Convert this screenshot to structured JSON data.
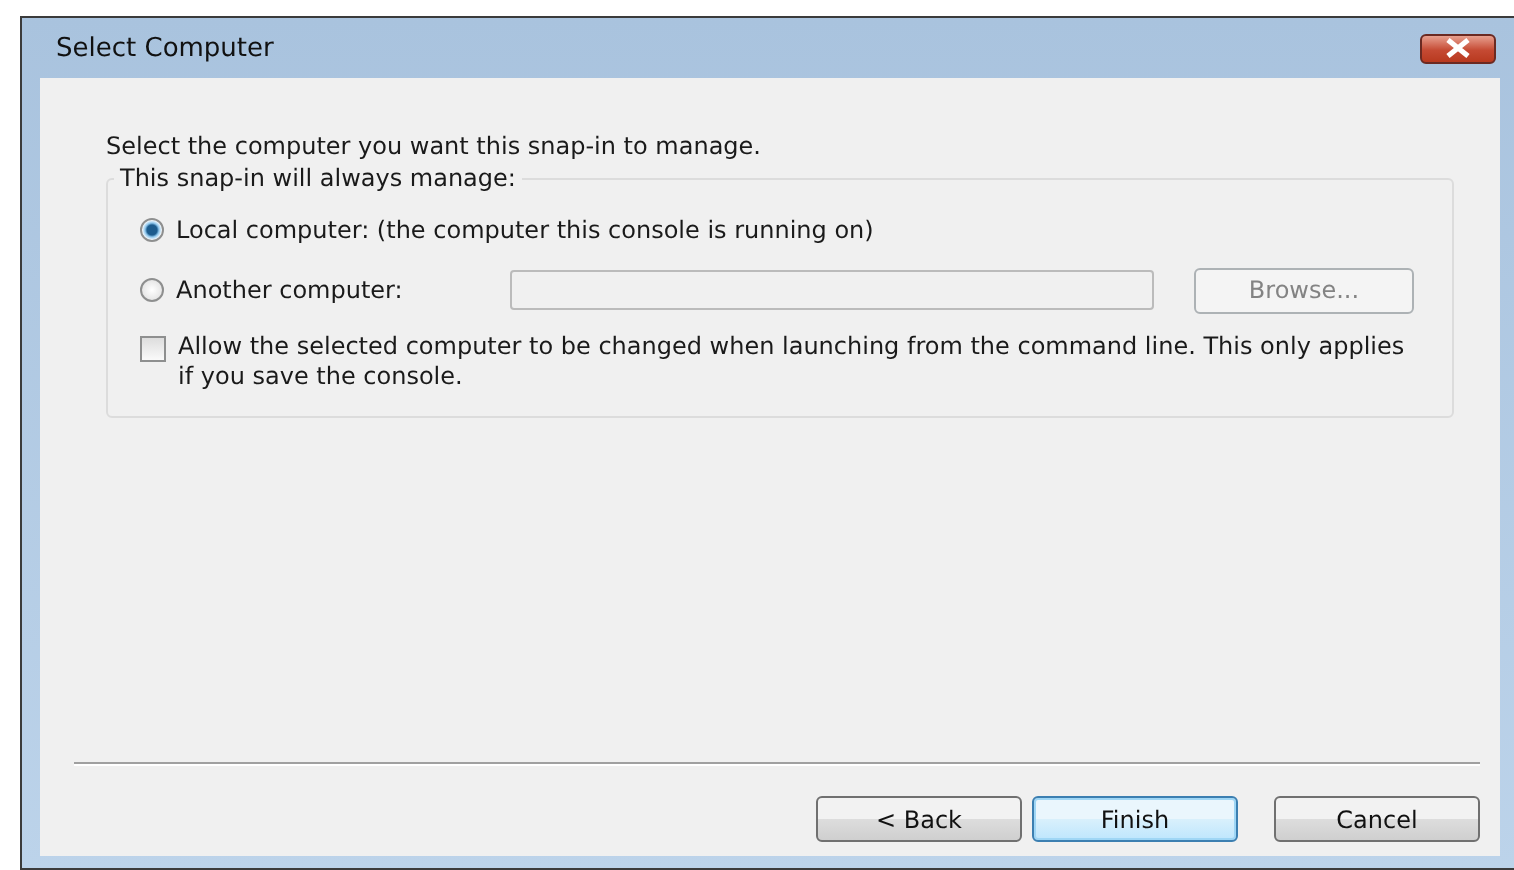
{
  "window": {
    "title": "Select Computer"
  },
  "instruction": "Select the computer you want this snap-in to manage.",
  "group": {
    "label": "This snap-in will always manage:",
    "options": [
      {
        "label": "Local computer:  (the computer this console is running on)",
        "selected": true
      },
      {
        "label": "Another computer:",
        "selected": false
      }
    ],
    "computer_field": {
      "disabled": true
    },
    "browse_button": {
      "label": "Browse...",
      "disabled": true
    },
    "allow_change": {
      "label": "Allow the selected computer to be changed when launching from the command line.  This only applies if you save the console.",
      "checked": false
    }
  },
  "buttons": [
    {
      "label": "< Back",
      "focused": false
    },
    {
      "label": "Finish",
      "focused": true
    },
    {
      "label": "Cancel",
      "focused": false
    }
  ]
}
